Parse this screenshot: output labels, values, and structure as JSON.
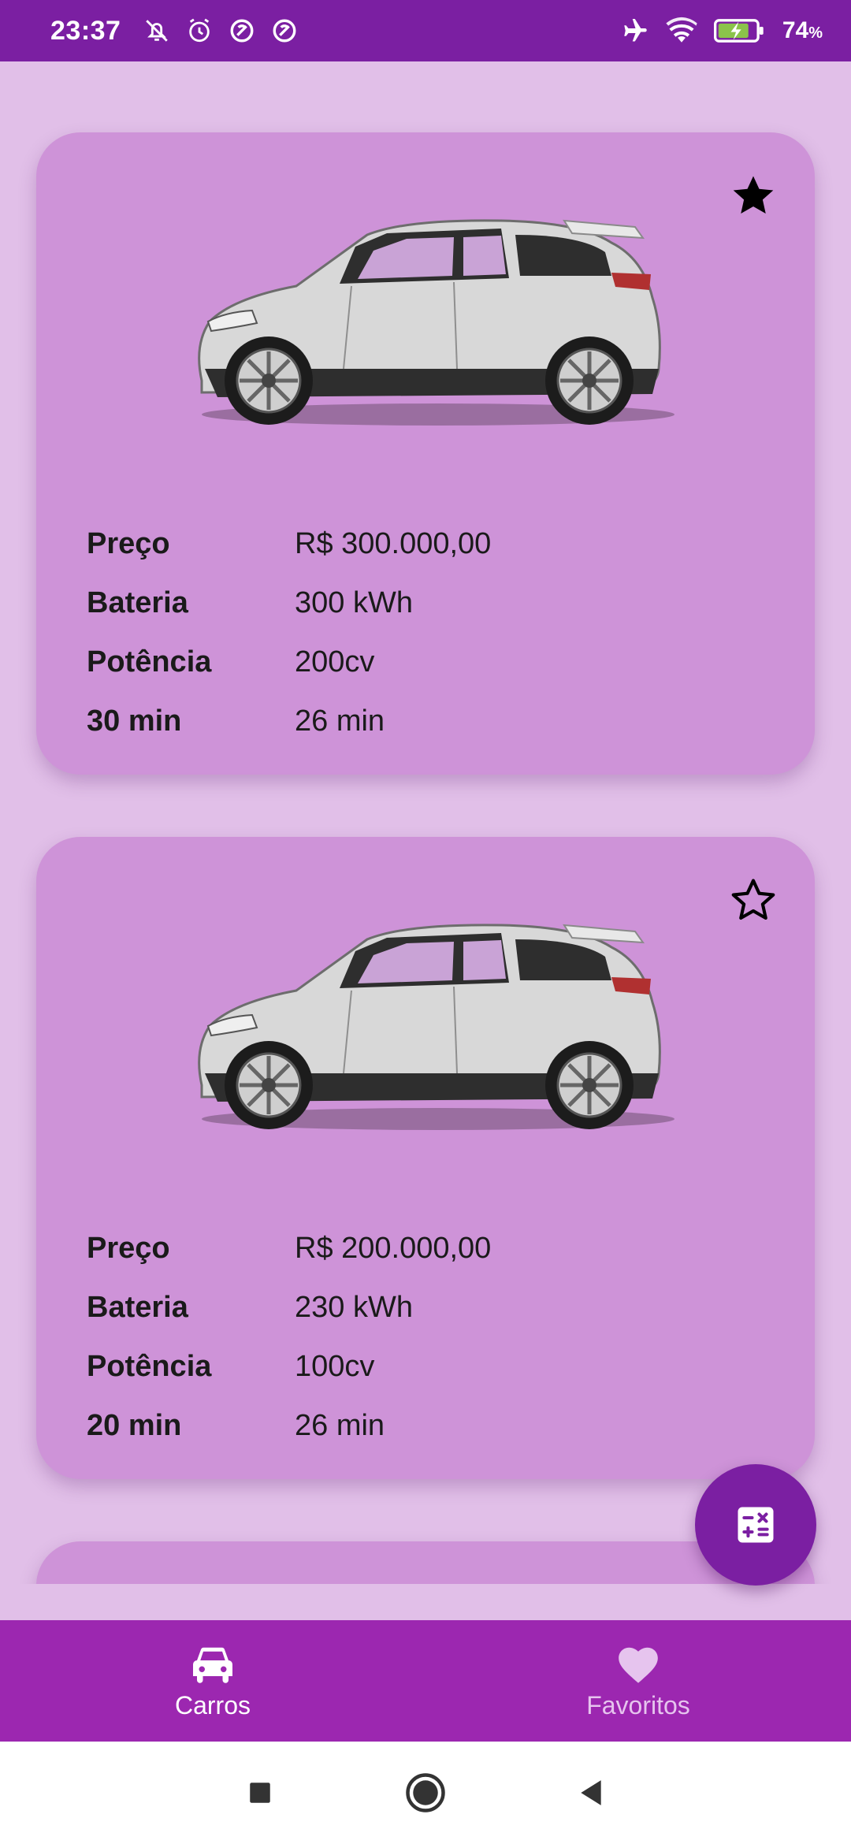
{
  "status_bar": {
    "time": "23:37",
    "battery_percent": "74",
    "battery_unit": "%",
    "left_icons": [
      "bell-off-icon",
      "alarm-icon",
      "data-saver-icon",
      "data-saver-icon"
    ],
    "right_icons": [
      "airplane-icon",
      "wifi-icon",
      "battery-charging-icon"
    ]
  },
  "cars": [
    {
      "favorite": true,
      "image": "electric-hatchback-white",
      "specs": [
        {
          "label": "Preço",
          "value": "R$ 300.000,00"
        },
        {
          "label": "Bateria",
          "value": "300 kWh"
        },
        {
          "label": "Potência",
          "value": "200cv"
        },
        {
          "label": "30 min",
          "value": "26 min"
        }
      ]
    },
    {
      "favorite": false,
      "image": "electric-hatchback-white",
      "specs": [
        {
          "label": "Preço",
          "value": "R$ 200.000,00"
        },
        {
          "label": "Bateria",
          "value": "230 kWh"
        },
        {
          "label": "Potência",
          "value": "100cv"
        },
        {
          "label": "20 min",
          "value": "26 min"
        }
      ]
    }
  ],
  "fab": {
    "icon": "calculator-icon"
  },
  "bottom_nav": {
    "items": [
      {
        "label": "Carros",
        "icon": "car-icon",
        "active": true
      },
      {
        "label": "Favoritos",
        "icon": "heart-icon",
        "active": false
      }
    ]
  },
  "system_nav": [
    "recents-button",
    "home-button",
    "back-button"
  ],
  "colors": {
    "primary": "#7b1fa2",
    "nav": "#9c27b0",
    "card": "#ce93d8",
    "background": "#e1bfe8"
  }
}
